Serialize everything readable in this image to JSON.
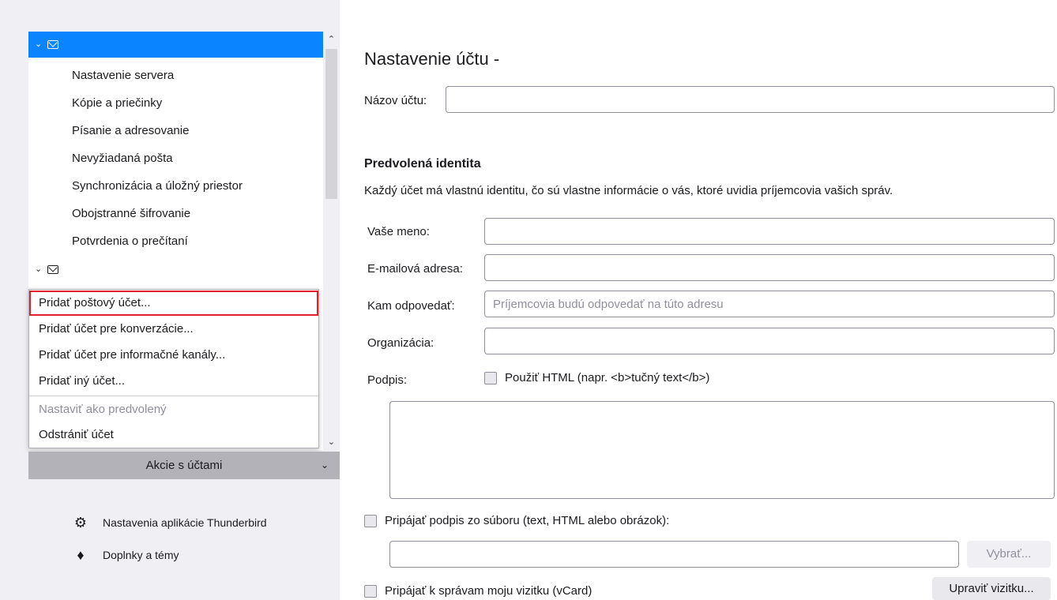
{
  "sidebar": {
    "account1_children": [
      "Nastavenie servera",
      "Kópie a priečinky",
      "Písanie a adresovanie",
      "Nevyžiadaná pošta",
      "Synchronizácia a úložný priestor",
      "Obojstranné šifrovanie",
      "Potvrdenia o prečítaní"
    ],
    "menu": {
      "add_mail_account": "Pridať poštový účet...",
      "add_chat_account": "Pridať účet pre konverzácie...",
      "add_feed_account": "Pridať účet pre informačné kanály...",
      "add_other_account": "Pridať iný účet...",
      "set_default": "Nastaviť ako predvolený",
      "remove_account": "Odstrániť účet"
    },
    "account_actions": "Akcie s účtami",
    "app_settings": "Nastavenia aplikácie Thunderbird",
    "addons": "Doplnky a témy"
  },
  "main": {
    "title": "Nastavenie účtu -",
    "account_name_label": "Názov účtu:",
    "account_name_value": "",
    "default_identity_title": "Predvolená identita",
    "default_identity_desc": "Každý účet má vlastnú identitu, čo sú vlastne informácie o vás, ktoré uvidia príjemcovia vašich správ.",
    "name_label": "Vaše meno:",
    "email_label": "E-mailová adresa:",
    "reply_to_label": "Kam odpovedať:",
    "reply_to_placeholder": "Príjemcovia budú odpovedať na túto adresu",
    "organization_label": "Organizácia:",
    "signature_label": "Podpis:",
    "use_html_label": "Použiť HTML (napr. <b>tučný text</b>)",
    "attach_signature_file_label": "Pripájať podpis zo súboru (text, HTML alebo obrázok):",
    "choose_button": "Vybrať...",
    "attach_vcard_label": "Pripájať k správam moju vizitku (vCard)",
    "edit_card_button": "Upraviť vizitku..."
  }
}
